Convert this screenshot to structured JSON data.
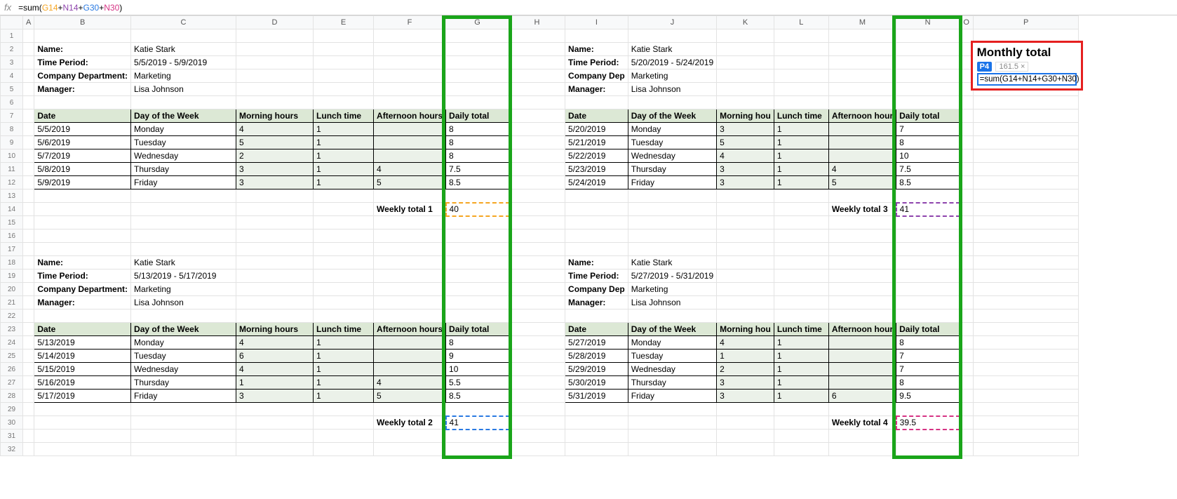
{
  "formula_bar": {
    "prefix": "=sum(",
    "ref1": "G14",
    "ref2": "N14",
    "ref3": "G30",
    "ref4": "N30",
    "suffix": ")"
  },
  "columns": [
    "",
    "A",
    "B",
    "C",
    "D",
    "E",
    "F",
    "G",
    "H",
    "I",
    "J",
    "K",
    "L",
    "M",
    "N",
    "O",
    "P"
  ],
  "rows": 32,
  "blocks": {
    "b1": {
      "name_label": "Name:",
      "name": "Katie Stark",
      "period_label": "Time Period:",
      "period": "5/5/2019 - 5/9/2019",
      "dept_label": "Company Department:",
      "dept": "Marketing",
      "mgr_label": "Manager:",
      "mgr": "Lisa Johnson",
      "hdr": [
        "Date",
        "Day of the Week",
        "Morning hours",
        "Lunch time",
        "Afternoon hours",
        "Daily total"
      ],
      "rows": [
        [
          "5/5/2019",
          "Monday",
          "4",
          "1",
          "",
          "8"
        ],
        [
          "5/6/2019",
          "Tuesday",
          "5",
          "1",
          "",
          "8"
        ],
        [
          "5/7/2019",
          "Wednesday",
          "2",
          "1",
          "",
          "8"
        ],
        [
          "5/8/2019",
          "Thursday",
          "3",
          "1",
          "4",
          "7.5"
        ],
        [
          "5/9/2019",
          "Friday",
          "3",
          "1",
          "5",
          "8.5"
        ]
      ],
      "weekly_label": "Weekly total 1",
      "weekly_val": "40"
    },
    "b2": {
      "name_label": "Name:",
      "name": "Katie Stark",
      "period_label": "Time Period:",
      "period": "5/20/2019 - 5/24/2019",
      "dept_label": "Company Dep",
      "dept": "Marketing",
      "mgr_label": "Manager:",
      "mgr": "Lisa Johnson",
      "hdr": [
        "Date",
        "Day of the Week",
        "Morning hou",
        "Lunch time",
        "Afternoon hour",
        "Daily total"
      ],
      "rows": [
        [
          "5/20/2019",
          "Monday",
          "3",
          "1",
          "",
          "7"
        ],
        [
          "5/21/2019",
          "Tuesday",
          "5",
          "1",
          "",
          "8"
        ],
        [
          "5/22/2019",
          "Wednesday",
          "4",
          "1",
          "",
          "10"
        ],
        [
          "5/23/2019",
          "Thursday",
          "3",
          "1",
          "4",
          "7.5"
        ],
        [
          "5/24/2019",
          "Friday",
          "3",
          "1",
          "5",
          "8.5"
        ]
      ],
      "weekly_label": "Weekly total 3",
      "weekly_val": "41"
    },
    "b3": {
      "name_label": "Name:",
      "name": "Katie Stark",
      "period_label": "Time Period:",
      "period": "5/13/2019 - 5/17/2019",
      "dept_label": "Company Department:",
      "dept": "Marketing",
      "mgr_label": "Manager:",
      "mgr": "Lisa Johnson",
      "hdr": [
        "Date",
        "Day of the Week",
        "Morning hours",
        "Lunch time",
        "Afternoon hours",
        "Daily total"
      ],
      "rows": [
        [
          "5/13/2019",
          "Monday",
          "4",
          "1",
          "",
          "8"
        ],
        [
          "5/14/2019",
          "Tuesday",
          "6",
          "1",
          "",
          "9"
        ],
        [
          "5/15/2019",
          "Wednesday",
          "4",
          "1",
          "",
          "10"
        ],
        [
          "5/16/2019",
          "Thursday",
          "1",
          "1",
          "4",
          "5.5"
        ],
        [
          "5/17/2019",
          "Friday",
          "3",
          "1",
          "5",
          "8.5"
        ]
      ],
      "weekly_label": "Weekly total 2",
      "weekly_val": "41"
    },
    "b4": {
      "name_label": "Name:",
      "name": "Katie Stark",
      "period_label": "Time Period:",
      "period": "5/27/2019 - 5/31/2019",
      "dept_label": "Company Dep",
      "dept": "Marketing",
      "mgr_label": "Manager:",
      "mgr": "Lisa Johnson",
      "hdr": [
        "Date",
        "Day of the Week",
        "Morning hou",
        "Lunch time",
        "Afternoon hour",
        "Daily total"
      ],
      "rows": [
        [
          "5/27/2019",
          "Monday",
          "4",
          "1",
          "",
          "8"
        ],
        [
          "5/28/2019",
          "Tuesday",
          "1",
          "1",
          "",
          "7"
        ],
        [
          "5/29/2019",
          "Wednesday",
          "2",
          "1",
          "",
          "7"
        ],
        [
          "5/30/2019",
          "Thursday",
          "3",
          "1",
          "",
          "8"
        ],
        [
          "5/31/2019",
          "Friday",
          "3",
          "1",
          "6",
          "9.5"
        ]
      ],
      "weekly_label": "Weekly total 4",
      "weekly_val": "39.5"
    }
  },
  "callout": {
    "title": "Monthly total",
    "cell": "P4",
    "preview": "161.5 ×",
    "formula_prefix": "=sum(",
    "ref1": "G14",
    "ref2": "N14",
    "ref3": "G30",
    "ref4": "N30",
    "formula_suffix": ")"
  }
}
